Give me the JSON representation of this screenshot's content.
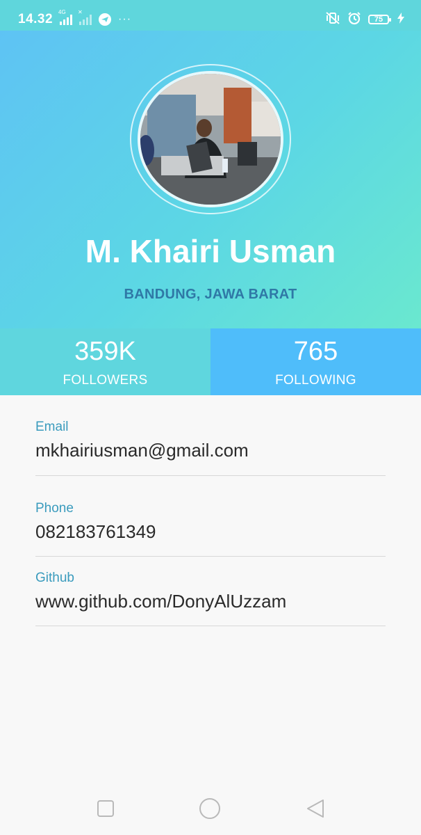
{
  "status_bar": {
    "time": "14.32",
    "sim1_label": "4G",
    "sim2_label": "✕",
    "more": "···",
    "battery_level": "75"
  },
  "profile": {
    "name": "M. Khairi Usman",
    "location": "BANDUNG, JAWA BARAT"
  },
  "stats": {
    "followers": {
      "value": "359K",
      "label": "FOLLOWERS"
    },
    "following": {
      "value": "765",
      "label": "FOLLOWING"
    }
  },
  "details": {
    "email": {
      "label": "Email",
      "value": "mkhairiusman@gmail.com"
    },
    "phone": {
      "label": "Phone",
      "value": "082183761349"
    },
    "github": {
      "label": "Github",
      "value": "www.github.com/DonyAlUzzam"
    }
  },
  "colors": {
    "header_gradient_start": "#5ec3f4",
    "header_gradient_end": "#6ae8cf",
    "followers_bg": "#5fd6de",
    "following_bg": "#4fbdfa",
    "label_color": "#3a9bbd",
    "location_color": "#2f78a6"
  },
  "icons": {
    "telegram": "telegram-icon",
    "mute": "vibrate-mute-icon",
    "alarm": "alarm-icon",
    "charging": "charging-bolt-icon",
    "nav_recents": "square-recents-icon",
    "nav_home": "circle-home-icon",
    "nav_back": "triangle-back-icon"
  }
}
